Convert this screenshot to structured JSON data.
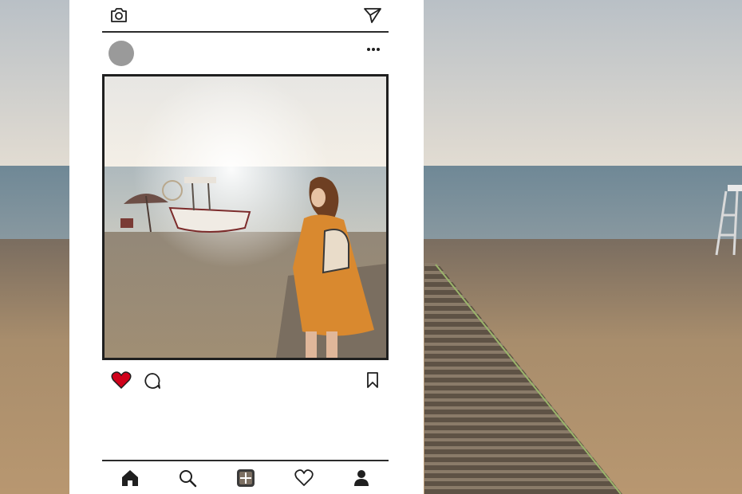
{
  "scene": {
    "description_free": true
  },
  "header": {
    "left_icon": "camera-icon",
    "right_icon": "direct-message-icon"
  },
  "post": {
    "avatar": "avatar-placeholder",
    "menu_icon": "more-options-icon"
  },
  "actions": {
    "like_icon": "heart-filled-icon",
    "like_color": "#d0021b",
    "comment_icon": "comment-icon",
    "save_icon": "bookmark-icon"
  },
  "bottom_nav": {
    "items": [
      "home-icon",
      "search-icon",
      "reels-icon",
      "activity-heart-icon",
      "profile-icon"
    ]
  },
  "colors": {
    "frame": "#ffffff",
    "ink": "#1f1f1f",
    "avatar": "#9a9a9a"
  }
}
